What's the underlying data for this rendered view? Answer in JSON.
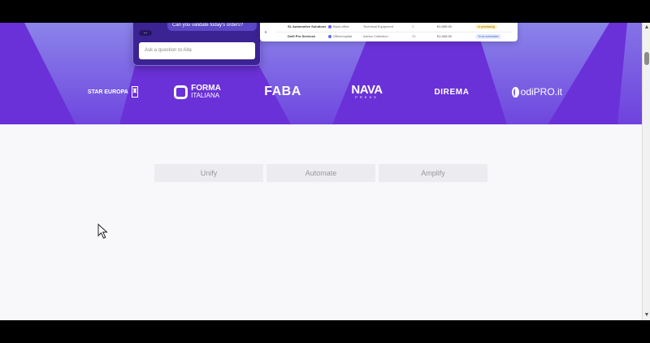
{
  "chat": {
    "message": "Can you validate today's orders?",
    "typing": "...",
    "input_placeholder": "Ask a question to Aita"
  },
  "orders_table": {
    "rows": [
      {
        "name": "SL Automotive Solutions",
        "office": "Back-office",
        "category": "Technical Equipment",
        "quantity": "3",
        "amount": "€1,500.00",
        "status": "In processing",
        "status_color": "#9a6c00"
      },
      {
        "name": "Delfi Pro Services",
        "office": "Office/capital",
        "category": "Advice Collection",
        "quantity": "25",
        "amount": "€1,400.00",
        "status": "To be scheduled",
        "status_color": "#4359b5"
      }
    ]
  },
  "logos": {
    "star_europa": "STAR EUROPA",
    "forma_main": "FORMA",
    "forma_sub": "ITALIANA",
    "faba": "FABA",
    "nava_main": "NAVA",
    "nava_sub": "PRESS",
    "direma": "DIREMA",
    "odi_pro": "odiPRO.it"
  },
  "tabs": [
    {
      "label": "Unify"
    },
    {
      "label": "Automate"
    },
    {
      "label": "Amplify"
    }
  ],
  "colors": {
    "hero_background": "#6a31d8",
    "chat_background": "#3b2394",
    "tab_background": "#ececf0"
  },
  "icons": {
    "send": "send-icon",
    "pointer": "mouse-pointer-icon",
    "scroll_up": "chevron-up-icon",
    "scroll_down": "chevron-down-icon"
  }
}
